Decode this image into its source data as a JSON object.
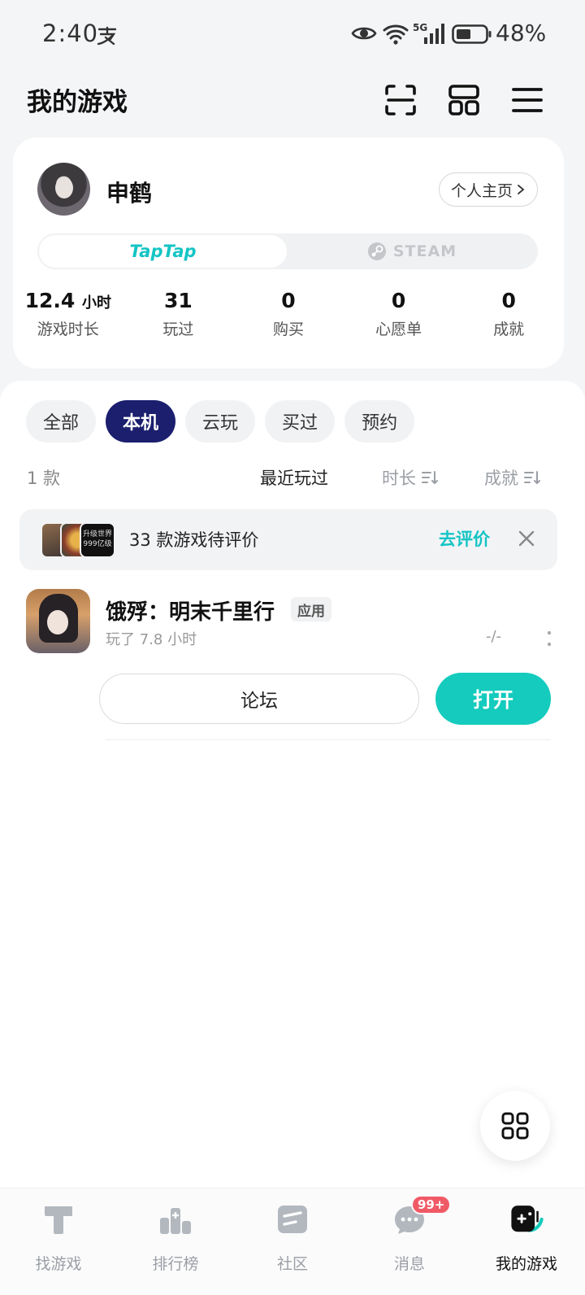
{
  "status_bar": {
    "time": "2:40",
    "battery": "48%"
  },
  "header": {
    "title": "我的游戏"
  },
  "profile": {
    "username": "申鹤",
    "homepage_label": "个人主页",
    "platforms": [
      "TapTap",
      "STEAM"
    ],
    "stats": [
      {
        "value": "12.4",
        "unit": "小时",
        "label": "游戏时长"
      },
      {
        "value": "31",
        "unit": "",
        "label": "玩过"
      },
      {
        "value": "0",
        "unit": "",
        "label": "购买"
      },
      {
        "value": "0",
        "unit": "",
        "label": "心愿单"
      },
      {
        "value": "0",
        "unit": "",
        "label": "成就"
      }
    ]
  },
  "filters": {
    "chips": [
      "全部",
      "本机",
      "云玩",
      "买过",
      "预约"
    ],
    "active": "本机",
    "count": "1 款",
    "sort": {
      "recent": "最近玩过",
      "duration": "时长",
      "achievement": "成就"
    }
  },
  "review_banner": {
    "text": "33 款游戏待评价",
    "action": "去评价",
    "thumb_caption": "升级世界 999亿级"
  },
  "game": {
    "title": "饿殍：明末千里行",
    "tag": "应用",
    "playtime": "玩了 7.8 小时",
    "score": "-/-",
    "forum_label": "论坛",
    "open_label": "打开"
  },
  "bottom_nav": [
    {
      "label": "找游戏",
      "icon": "find-games-icon"
    },
    {
      "label": "排行榜",
      "icon": "ranking-icon"
    },
    {
      "label": "社区",
      "icon": "community-icon"
    },
    {
      "label": "消息",
      "icon": "message-icon",
      "badge": "99+"
    },
    {
      "label": "我的游戏",
      "icon": "my-games-icon",
      "active": true
    }
  ],
  "colors": {
    "accent": "#14cbbd",
    "active_chip": "#1b1f6e",
    "badge": "#f05a66"
  }
}
